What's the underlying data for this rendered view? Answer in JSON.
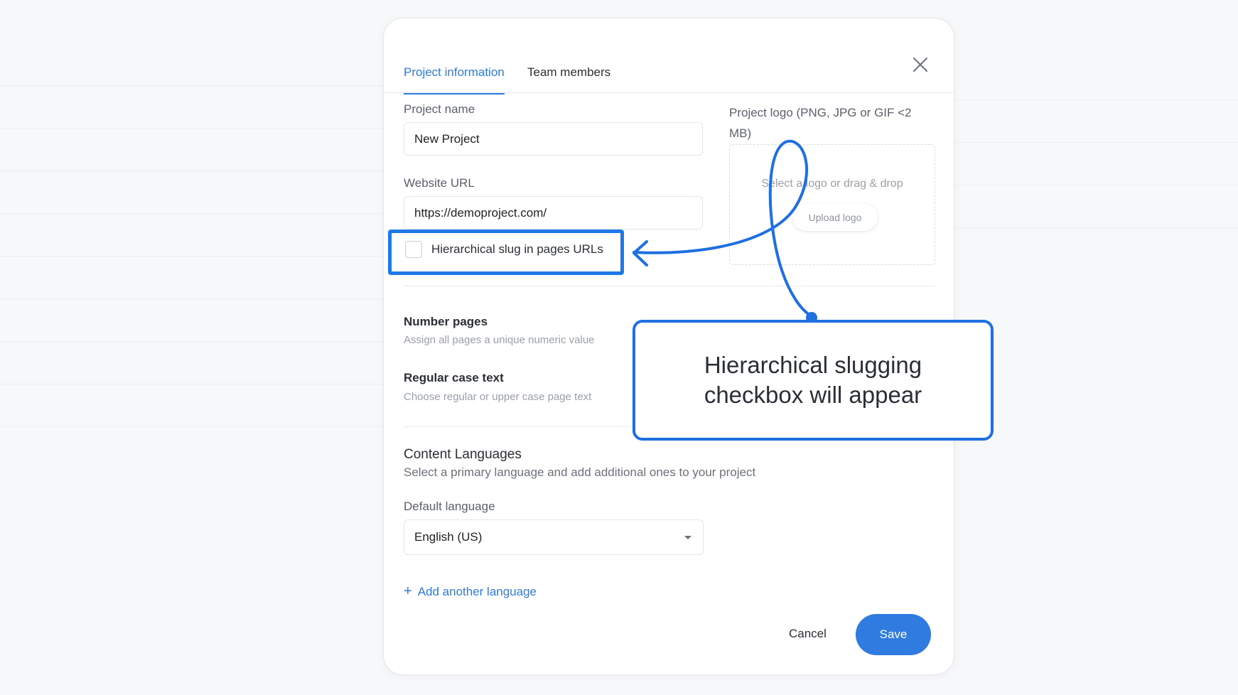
{
  "modal": {
    "tabs": [
      {
        "label": "Project information",
        "active": true
      },
      {
        "label": "Team members",
        "active": false
      }
    ],
    "close_icon": "close-icon"
  },
  "form": {
    "project_name_label": "Project name",
    "project_name_value": "New Project",
    "website_url_label": "Website URL",
    "website_url_value": "https://demoproject.com/",
    "hierarchical_slug_label": "Hierarchical slug in pages URLs",
    "hierarchical_slug_checked": false,
    "logo_label": "Project logo (PNG, JPG or GIF <2 MB)",
    "logo_hint": "Select a logo or drag & drop",
    "upload_button": "Upload logo",
    "number_pages_title": "Number pages",
    "number_pages_sub": "Assign all pages a unique numeric value",
    "regular_case_title": "Regular case text",
    "regular_case_sub": "Choose regular or upper case page text",
    "content_languages_title": "Content Languages",
    "content_languages_sub": "Select a primary language and add additional ones to your project",
    "default_language_label": "Default language",
    "default_language_value": "English (US)",
    "add_language": "Add another language",
    "cancel_button": "Cancel",
    "save_button": "Save"
  },
  "annotation": {
    "callout_text": "Hierarchical slugging checkbox will appear",
    "color": "#1f6fe0"
  },
  "colors": {
    "accent": "#2f7be0",
    "annotation": "#1f7ae8"
  }
}
